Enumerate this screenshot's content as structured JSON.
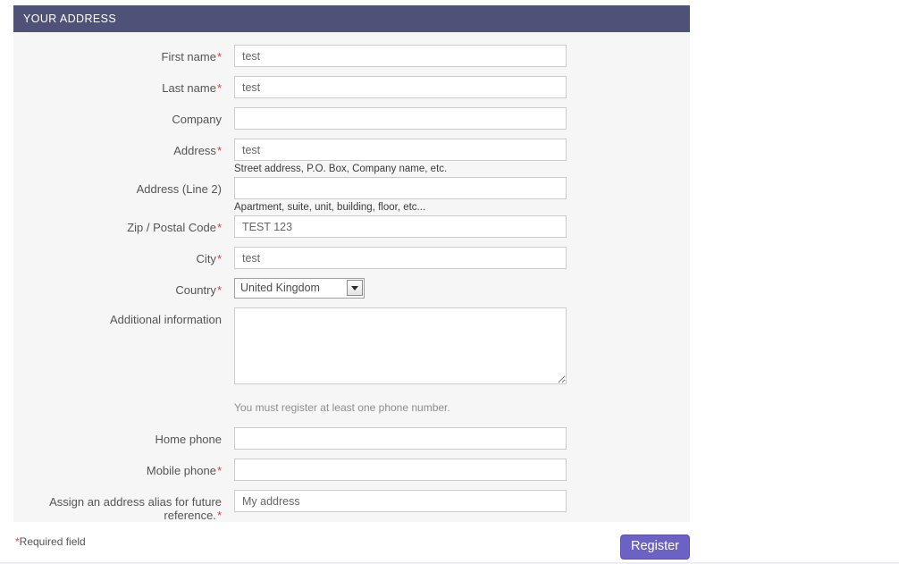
{
  "panel": {
    "title": "YOUR ADDRESS"
  },
  "form": {
    "fields": [
      {
        "key": "first_name",
        "label": "First name",
        "required": true,
        "type": "text",
        "value": "test",
        "placeholder": "",
        "help": ""
      },
      {
        "key": "last_name",
        "label": "Last name",
        "required": true,
        "type": "text",
        "value": "test",
        "placeholder": "",
        "help": ""
      },
      {
        "key": "company",
        "label": "Company",
        "required": false,
        "type": "text",
        "value": "",
        "placeholder": "",
        "help": ""
      },
      {
        "key": "address",
        "label": "Address",
        "required": true,
        "type": "text",
        "value": "test",
        "placeholder": "",
        "help": "Street address, P.O. Box, Company name, etc."
      },
      {
        "key": "address_line2",
        "label": "Address (Line 2)",
        "required": false,
        "type": "text",
        "value": "",
        "placeholder": "",
        "help": "Apartment, suite, unit, building, floor, etc..."
      },
      {
        "key": "zip",
        "label": "Zip / Postal Code",
        "required": true,
        "type": "text",
        "value": "TEST 123",
        "placeholder": "",
        "help": ""
      },
      {
        "key": "city",
        "label": "City",
        "required": true,
        "type": "text",
        "value": "test",
        "placeholder": "",
        "help": ""
      }
    ],
    "country": {
      "label": "Country",
      "required": true,
      "selected": "United Kingdom",
      "options": [
        "United Kingdom"
      ]
    },
    "additional_information": {
      "label": "Additional information",
      "required": false,
      "value": "",
      "placeholder": ""
    },
    "phone_note": "You must register at least one phone number.",
    "phones": [
      {
        "key": "home_phone",
        "label": "Home phone",
        "required": false,
        "value": "",
        "placeholder": ""
      },
      {
        "key": "mobile_phone",
        "label": "Mobile phone",
        "required": true,
        "value": "",
        "placeholder": ""
      }
    ],
    "alias": {
      "key": "address_alias",
      "label": "Assign an address alias for future reference.",
      "required": true,
      "value": "My address",
      "placeholder": ""
    },
    "required_marker": "*"
  },
  "footer": {
    "required_star": "*",
    "required_text": "Required field",
    "register_label": "Register"
  },
  "colors": {
    "header_bg": "#4e5278",
    "panel_bg": "#f6f6f6",
    "button_bg": "#6c62c4",
    "required_red": "#f13340",
    "label_text": "#555454"
  }
}
